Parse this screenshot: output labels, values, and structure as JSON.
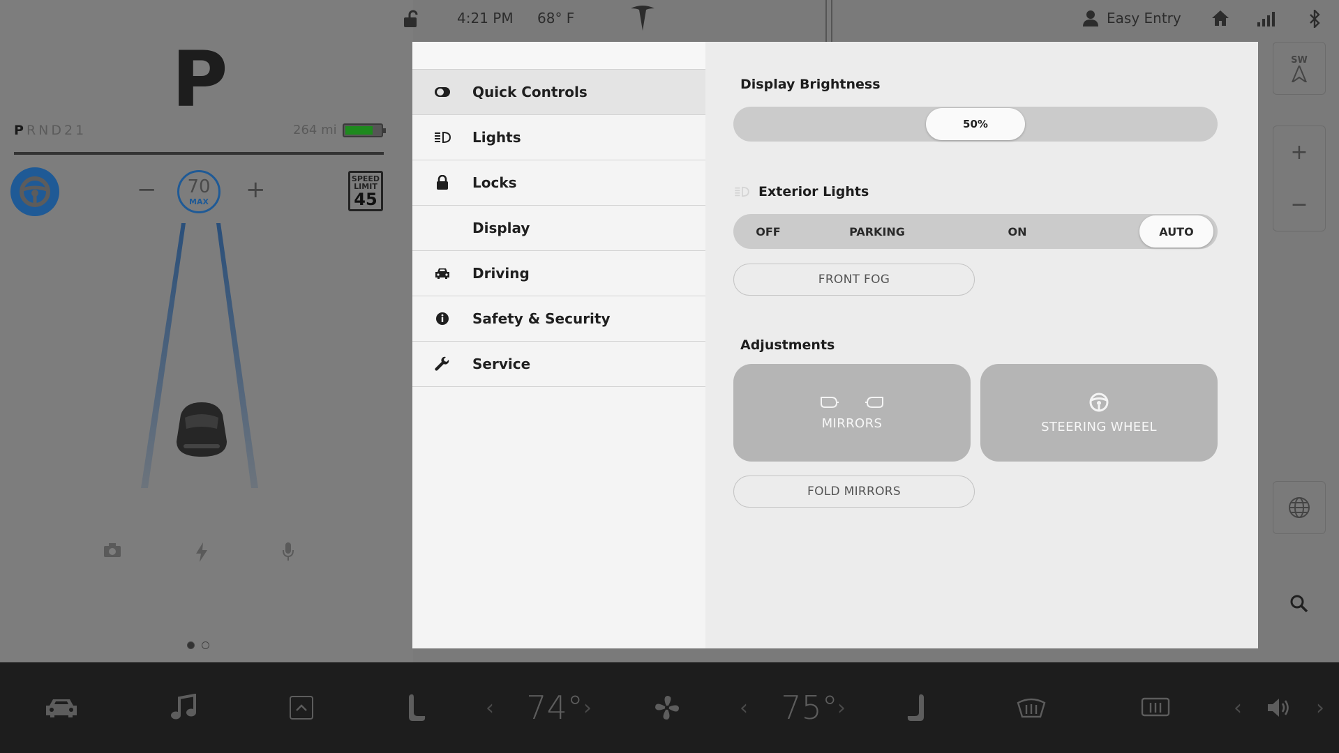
{
  "status_bar": {
    "time": "4:21 PM",
    "temperature": "68° F",
    "profile": "Easy Entry"
  },
  "drive": {
    "gear": "P",
    "gear_sequence_active": "P",
    "gear_sequence_rest": "RND21",
    "range": "264 mi",
    "battery_level": 0.78,
    "set_speed": "70",
    "set_speed_label": "MAX",
    "speed_limit_title": "SPEED LIMIT",
    "speed_limit_value": "45",
    "minus": "−",
    "plus": "+"
  },
  "map": {
    "compass_heading": "SW"
  },
  "menu": {
    "items": [
      {
        "label": "Quick Controls",
        "icon": "toggle-icon"
      },
      {
        "label": "Lights",
        "icon": "headlight-icon"
      },
      {
        "label": "Locks",
        "icon": "lock-icon"
      },
      {
        "label": "Display",
        "icon": ""
      },
      {
        "label": "Driving",
        "icon": "car-icon"
      },
      {
        "label": "Safety & Security",
        "icon": "info-icon"
      },
      {
        "label": "Service",
        "icon": "wrench-icon"
      }
    ],
    "active": "Quick Controls"
  },
  "panel": {
    "brightness_title": "Display Brightness",
    "brightness_value": "50%",
    "brightness_level": 0.5,
    "exterior_title": "Exterior Lights",
    "exterior_options": [
      "OFF",
      "PARKING",
      "ON",
      "AUTO"
    ],
    "exterior_selected": "AUTO",
    "front_fog": "FRONT FOG",
    "adjustments_title": "Adjustments",
    "mirrors": "MIRRORS",
    "steering_wheel": "STEERING WHEEL",
    "fold_mirrors": "FOLD MIRRORS"
  },
  "dock": {
    "driver_temp": "74°",
    "passenger_temp": "75°"
  },
  "colors": {
    "accent_blue": "#1f5a96",
    "battery_green": "#1e8a1e",
    "panel_bg": "#ececec",
    "dock_bg": "#1d1d1d"
  }
}
